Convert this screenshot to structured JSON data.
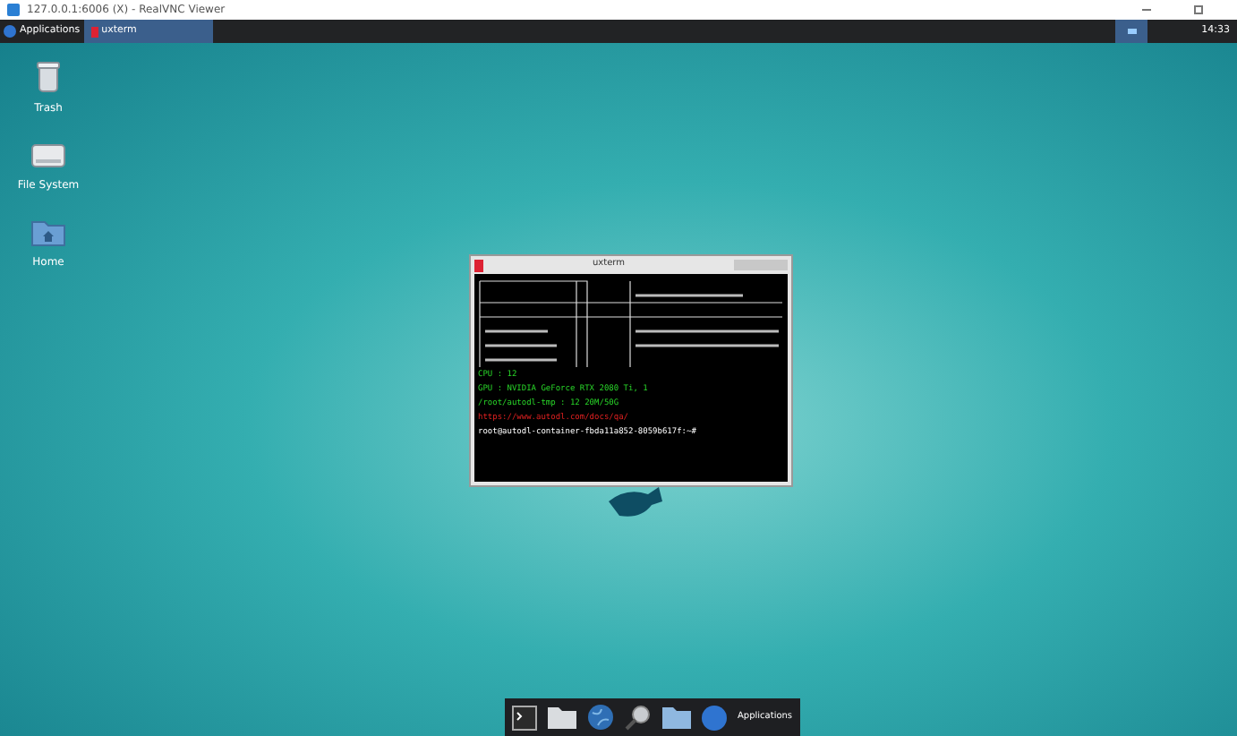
{
  "window": {
    "title": "127.0.0.1:6006 (X) - RealVNC Viewer"
  },
  "taskbar": {
    "menu": "Applications",
    "tasks": [
      {
        "label": "uxterm",
        "selected": true
      }
    ],
    "clock": "14:33"
  },
  "desktop_icons": [
    {
      "kind": "trash",
      "label": "Trash"
    },
    {
      "kind": "drive",
      "label": "File System"
    },
    {
      "kind": "home",
      "label": "Home"
    }
  ],
  "terminal": {
    "title": "uxterm",
    "lines": [
      {
        "kind": "green",
        "text": "CPU  : 12"
      },
      {
        "kind": "green",
        "text": "GPU  : NVIDIA GeForce RTX 2080 Ti, 1"
      },
      {
        "kind": "green",
        "text": "/root/autodl-tmp    : 12 20M/50G"
      },
      {
        "kind": "red",
        "text": "https://www.autodl.com/docs/qa/"
      },
      {
        "kind": "prompt",
        "text": "root@autodl-container-fbda11a852-8059b617f:~#"
      }
    ]
  },
  "dock": {
    "label": "Applications",
    "items": [
      {
        "kind": "terminal"
      },
      {
        "kind": "home"
      },
      {
        "kind": "globe"
      },
      {
        "kind": "search"
      },
      {
        "kind": "folder"
      }
    ]
  }
}
